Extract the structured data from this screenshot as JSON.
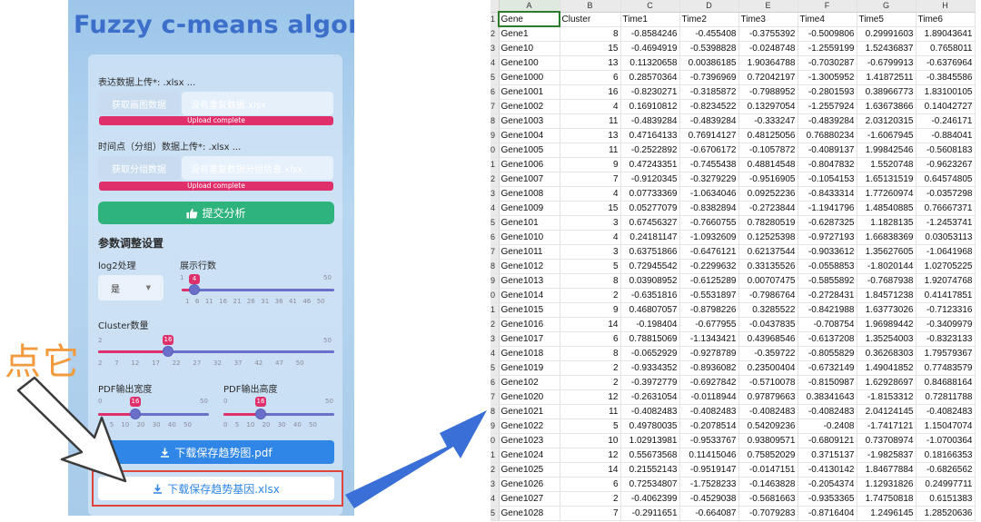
{
  "app": {
    "title": "Fuzzy c-means algorithm",
    "expr_upload_label": "表达数据上传*: .xlsx ...",
    "expr_browse_label": "获取画图数据",
    "expr_file_name": "没有重复数据.xlsx",
    "expr_progress": "Upload complete",
    "time_upload_label": "时间点（分组）数据上传*: .xlsx ...",
    "time_browse_label": "获取分组数据",
    "time_file_name": "没有重复数据分组信息.xlsx",
    "time_progress": "Upload complete",
    "submit_icon": "thumbs-up-icon",
    "submit_label": "提交分析",
    "params_heading": "参数调整设置",
    "log2_label": "log2处理",
    "log2_value": "是",
    "rows_label": "展示行数",
    "rows_slider": {
      "min": "1",
      "max": "50",
      "value": "4",
      "ticks": [
        "1",
        "6",
        "11",
        "16",
        "21",
        "26",
        "31",
        "36",
        "41",
        "46",
        "50"
      ]
    },
    "cluster_label": "Cluster数量",
    "cluster_slider": {
      "min": "2",
      "max": "50",
      "value": "16",
      "ticks": [
        "2",
        "7",
        "12",
        "17",
        "22",
        "27",
        "32",
        "37",
        "42",
        "47",
        "50"
      ]
    },
    "pdf_width_label": "PDF输出宽度",
    "pdf_width_slider": {
      "min": "0",
      "max": "50",
      "value": "16",
      "ticks": [
        "0",
        "5",
        "10",
        "20",
        "30",
        "40",
        "50"
      ]
    },
    "pdf_height_label": "PDF输出高度",
    "pdf_height_slider": {
      "min": "0",
      "max": "50",
      "value": "16",
      "ticks": [
        "0",
        "5",
        "10",
        "20",
        "30",
        "40",
        "50"
      ]
    },
    "download_icon": "download-icon",
    "download_pdf_label": "下载保存趋势图.pdf",
    "download_xlsx_label": "下载保存趋势基因.xlsx"
  },
  "annotation": {
    "click_label": "点它",
    "arrow_color": "#3a6fd8",
    "highlight_color": "#e0433a"
  },
  "spreadsheet": {
    "columns": [
      "A",
      "B",
      "C",
      "D",
      "E",
      "F",
      "G",
      "H"
    ],
    "row_numbers": [
      "1",
      "2",
      "3",
      "4",
      "5",
      "6",
      "7",
      "8",
      "9",
      "0",
      "1",
      "2",
      "3",
      "4",
      "5",
      "6",
      "7",
      "8",
      "9",
      "0",
      "1",
      "2",
      "3",
      "4",
      "5",
      "6",
      "7",
      "8",
      "9",
      "0",
      "1",
      "2",
      "3",
      "4",
      "5"
    ],
    "header": [
      "Gene",
      "Cluster",
      "Time1",
      "Time2",
      "Time3",
      "Time4",
      "Time5",
      "Time6"
    ],
    "rows": [
      [
        "Gene1",
        "8",
        "-0.8584246",
        "-0.455408",
        "-0.3755392",
        "-0.5009806",
        "0.29991603",
        "1.89043641"
      ],
      [
        "Gene10",
        "15",
        "-0.4694919",
        "-0.5398828",
        "-0.0248748",
        "-1.2559199",
        "1.52436837",
        "0.7658011"
      ],
      [
        "Gene100",
        "13",
        "0.11320658",
        "0.00386185",
        "1.90364788",
        "-0.7030287",
        "-0.6799913",
        "-0.6376964"
      ],
      [
        "Gene1000",
        "6",
        "0.28570364",
        "-0.7396969",
        "0.72042197",
        "-1.3005952",
        "1.41872511",
        "-0.3845586"
      ],
      [
        "Gene1001",
        "16",
        "-0.8230271",
        "-0.3185872",
        "-0.7988952",
        "-0.2801593",
        "0.38966773",
        "1.83100105"
      ],
      [
        "Gene1002",
        "4",
        "0.16910812",
        "-0.8234522",
        "0.13297054",
        "-1.2557924",
        "1.63673866",
        "0.14042727"
      ],
      [
        "Gene1003",
        "11",
        "-0.4839284",
        "-0.4839284",
        "-0.333247",
        "-0.4839284",
        "2.03120315",
        "-0.246171"
      ],
      [
        "Gene1004",
        "13",
        "0.47164133",
        "0.76914127",
        "0.48125056",
        "0.76880234",
        "-1.6067945",
        "-0.884041"
      ],
      [
        "Gene1005",
        "11",
        "-0.2522892",
        "-0.6706172",
        "-0.1057872",
        "-0.4089137",
        "1.99842546",
        "-0.5608183"
      ],
      [
        "Gene1006",
        "9",
        "0.47243351",
        "-0.7455438",
        "0.48814548",
        "-0.8047832",
        "1.5520748",
        "-0.9623267"
      ],
      [
        "Gene1007",
        "7",
        "-0.9120345",
        "-0.3279229",
        "-0.9516905",
        "-0.1054153",
        "1.65131519",
        "0.64574805"
      ],
      [
        "Gene1008",
        "4",
        "0.07733369",
        "-1.0634046",
        "0.09252236",
        "-0.8433314",
        "1.77260974",
        "-0.0357298"
      ],
      [
        "Gene1009",
        "15",
        "0.05277079",
        "-0.8382894",
        "-0.2723844",
        "-1.1941796",
        "1.48540885",
        "0.76667371"
      ],
      [
        "Gene101",
        "3",
        "0.67456327",
        "-0.7660755",
        "0.78280519",
        "-0.6287325",
        "1.1828135",
        "-1.2453741"
      ],
      [
        "Gene1010",
        "4",
        "0.24181147",
        "-1.0932609",
        "0.12525398",
        "-0.9727193",
        "1.66838369",
        "0.03053113"
      ],
      [
        "Gene1011",
        "3",
        "0.63751866",
        "-0.6476121",
        "0.62137544",
        "-0.9033612",
        "1.35627605",
        "-1.0641968"
      ],
      [
        "Gene1012",
        "5",
        "0.72945542",
        "-0.2299632",
        "0.33135526",
        "-0.0558853",
        "-1.8020144",
        "1.02705225"
      ],
      [
        "Gene1013",
        "8",
        "0.03908952",
        "-0.6125289",
        "0.00707475",
        "-0.5855892",
        "-0.7687938",
        "1.92074768"
      ],
      [
        "Gene1014",
        "2",
        "-0.6351816",
        "-0.5531897",
        "-0.7986764",
        "-0.2728431",
        "1.84571238",
        "0.41417851"
      ],
      [
        "Gene1015",
        "9",
        "0.46807057",
        "-0.8798226",
        "0.3285522",
        "-0.8421988",
        "1.63773026",
        "-0.7123316"
      ],
      [
        "Gene1016",
        "14",
        "-0.198404",
        "-0.677955",
        "-0.0437835",
        "-0.708754",
        "1.96989442",
        "-0.3409979"
      ],
      [
        "Gene1017",
        "6",
        "0.78815069",
        "-1.1343421",
        "0.43968546",
        "-0.6137208",
        "1.35254003",
        "-0.8323133"
      ],
      [
        "Gene1018",
        "8",
        "-0.0652929",
        "-0.9278789",
        "-0.359722",
        "-0.8055829",
        "0.36268303",
        "1.79579367"
      ],
      [
        "Gene1019",
        "2",
        "-0.9334352",
        "-0.8936082",
        "0.23500404",
        "-0.6732149",
        "1.49041852",
        "0.77483579"
      ],
      [
        "Gene102",
        "2",
        "-0.3972779",
        "-0.6927842",
        "-0.5710078",
        "-0.8150987",
        "1.62928697",
        "0.84688164"
      ],
      [
        "Gene1020",
        "12",
        "-0.2631054",
        "-0.0118944",
        "0.97879663",
        "0.38341643",
        "-1.8153312",
        "0.72811788"
      ],
      [
        "Gene1021",
        "11",
        "-0.4082483",
        "-0.4082483",
        "-0.4082483",
        "-0.4082483",
        "2.04124145",
        "-0.4082483"
      ],
      [
        "Gene1022",
        "5",
        "0.49780035",
        "-0.2078514",
        "0.54209236",
        "-0.2408",
        "-1.7417121",
        "1.15047074"
      ],
      [
        "Gene1023",
        "10",
        "1.02913981",
        "-0.9533767",
        "0.93809571",
        "-0.6809121",
        "0.73708974",
        "-1.0700364"
      ],
      [
        "Gene1024",
        "12",
        "0.55673568",
        "0.11415046",
        "0.75852029",
        "0.3715137",
        "-1.9825837",
        "0.18166353"
      ],
      [
        "Gene1025",
        "14",
        "0.21552143",
        "-0.9519147",
        "-0.0147151",
        "-0.4130142",
        "1.84677884",
        "-0.6826562"
      ],
      [
        "Gene1026",
        "6",
        "0.72534807",
        "-1.7528233",
        "-0.1463828",
        "-0.2054374",
        "1.12931826",
        "0.24997711"
      ],
      [
        "Gene1027",
        "2",
        "-0.4062399",
        "-0.4529038",
        "-0.5681663",
        "-0.9353365",
        "1.74750818",
        "0.6151383"
      ],
      [
        "Gene1028",
        "7",
        "-0.2911651",
        "-0.664087",
        "-0.7079283",
        "-0.8716404",
        "1.2496145",
        "1.28520636"
      ]
    ]
  }
}
